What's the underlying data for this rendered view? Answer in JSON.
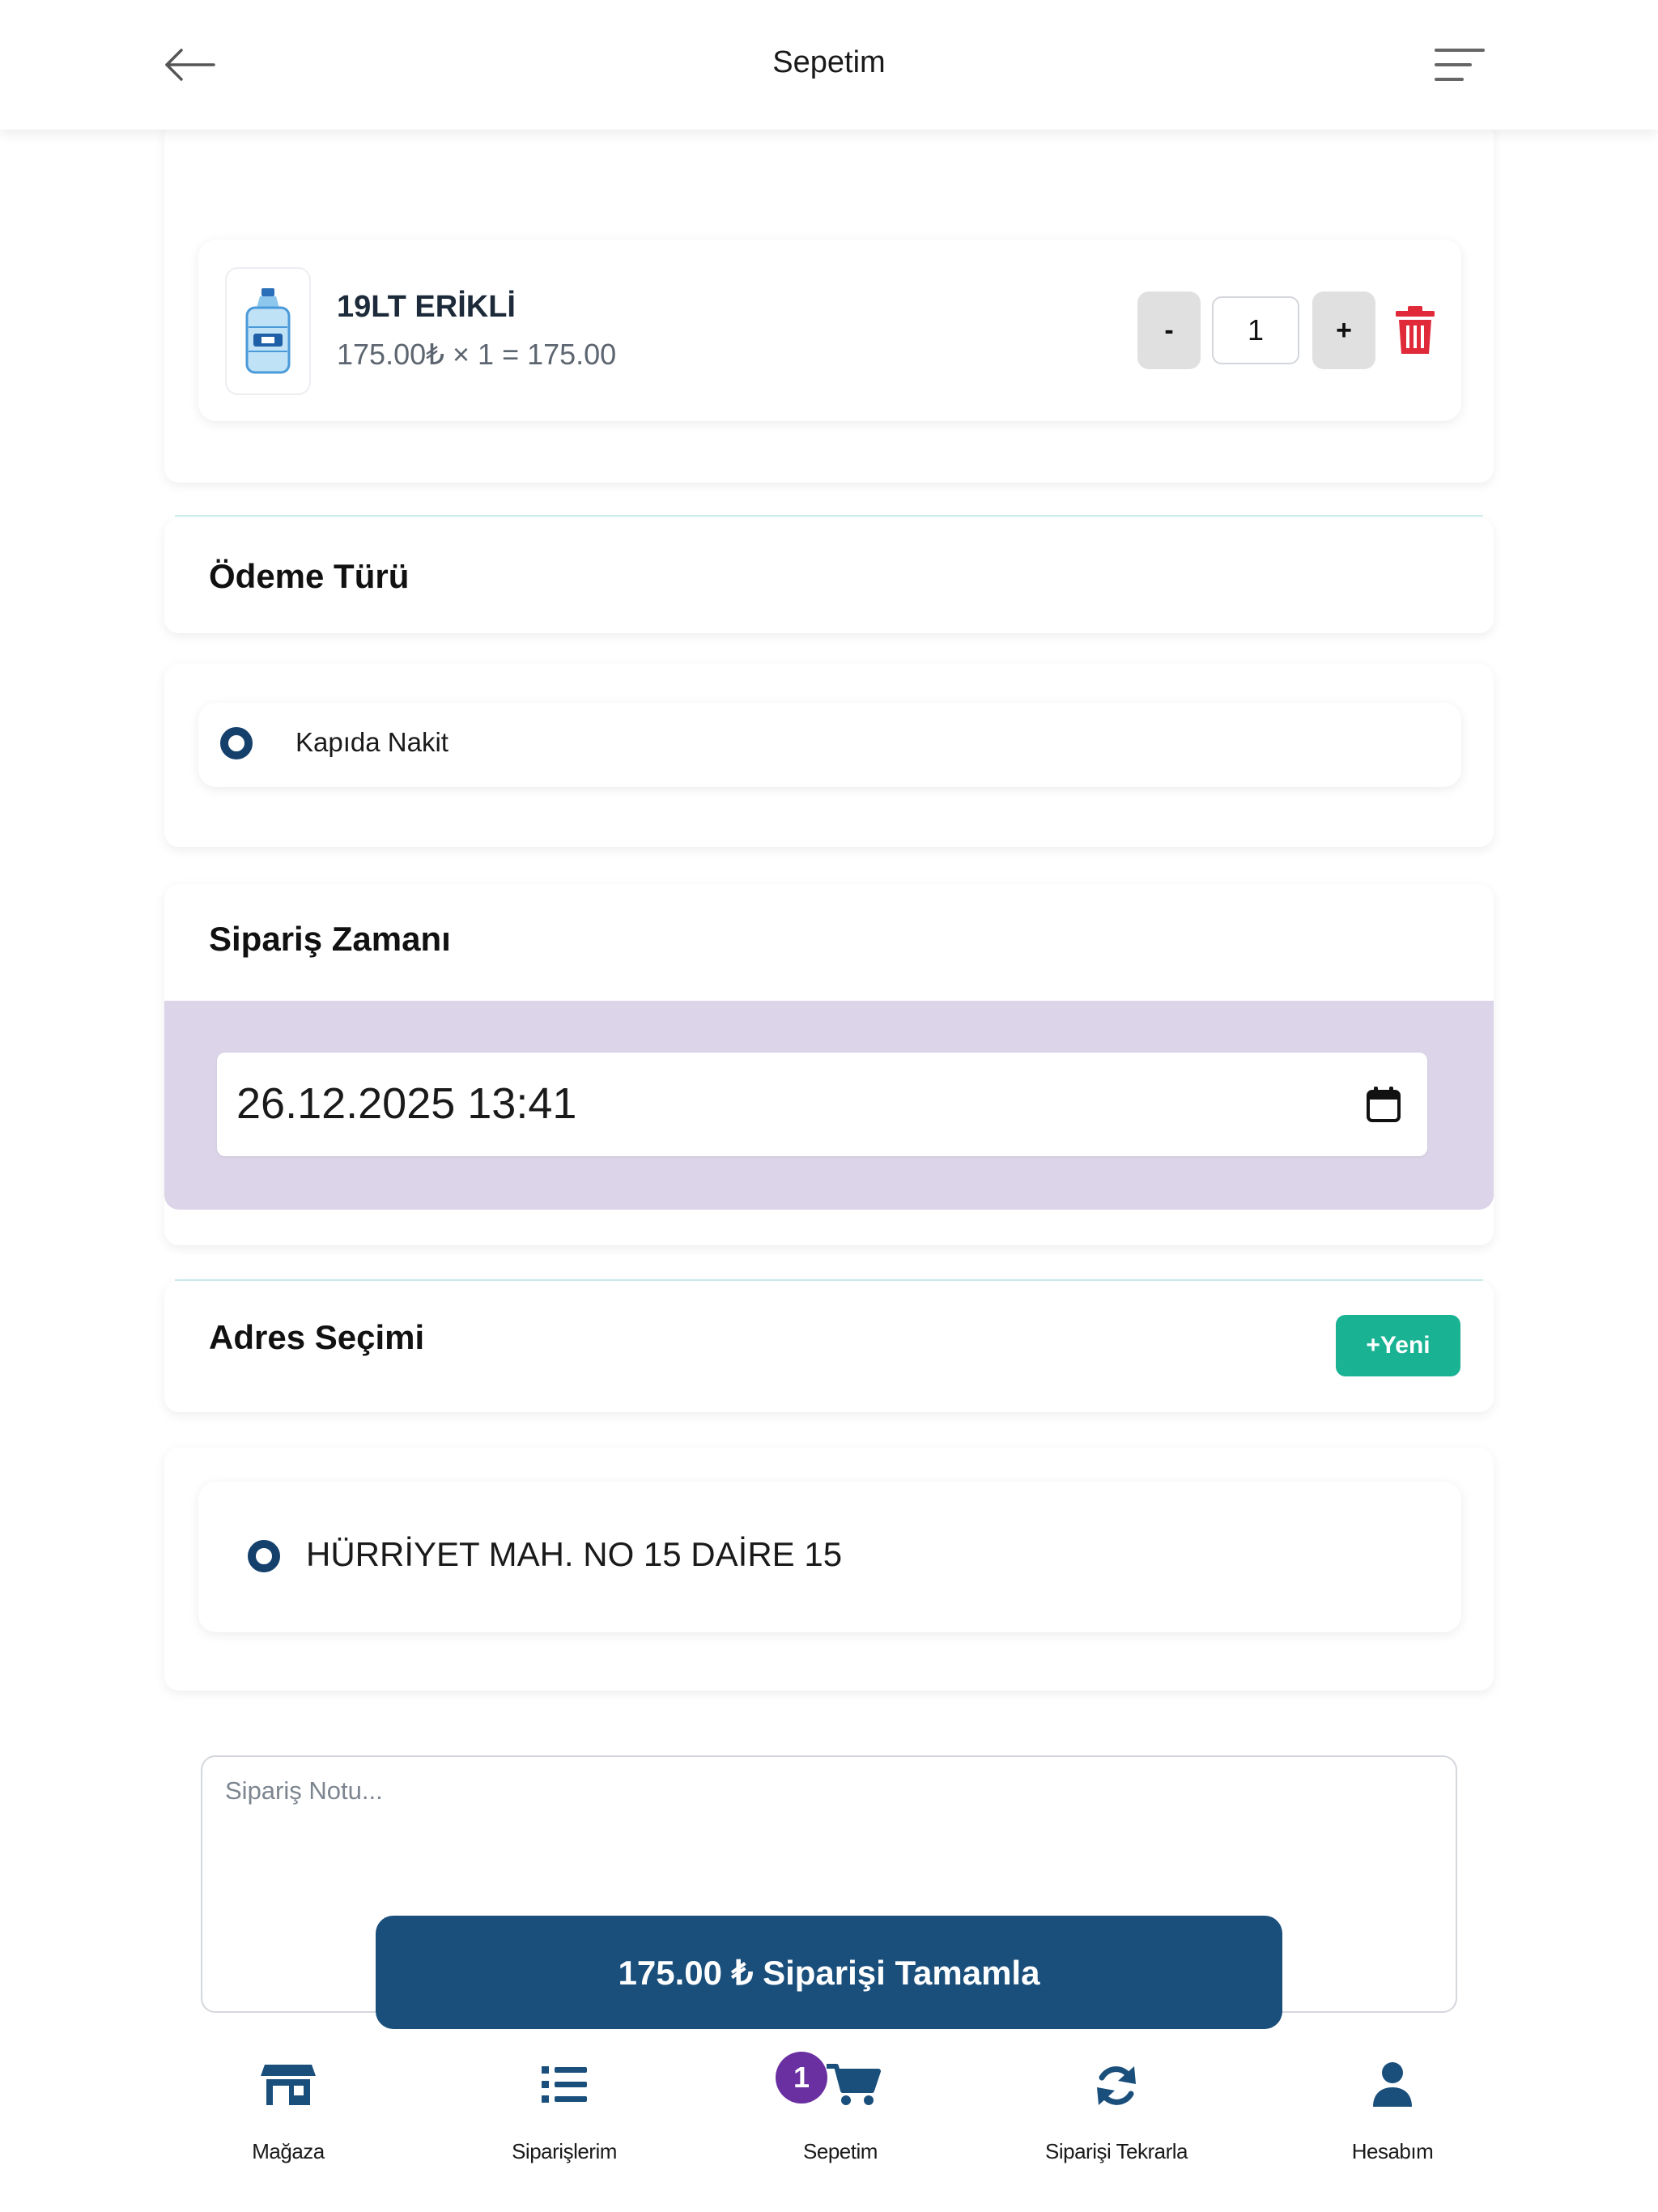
{
  "header": {
    "title": "Sepetim",
    "back_icon": "arrow-left-icon",
    "menu_icon": "menu-lines-icon"
  },
  "cart": {
    "items": [
      {
        "name": "19LT ERİKLİ",
        "price_line": "175.00₺ × 1 = 175.00",
        "quantity": "1",
        "minus_label": "-",
        "plus_label": "+",
        "image_icon": "water-bottle-icon",
        "delete_icon": "trash-icon"
      }
    ]
  },
  "payment": {
    "title": "Ödeme Türü",
    "options": [
      {
        "label": "Kapıda Nakit",
        "selected": true
      }
    ]
  },
  "order_time": {
    "title": "Sipariş Zamanı",
    "value": "26.12.2025 13:41",
    "icon": "calendar-icon"
  },
  "address": {
    "title": "Adres Seçimi",
    "new_button": "+Yeni",
    "options": [
      {
        "label": "HÜRRİYET MAH. NO 15 DAİRE 15",
        "selected": true
      }
    ]
  },
  "note": {
    "placeholder": "Sipariş Notu..."
  },
  "checkout": {
    "label": "175.00 ₺ Siparişi Tamamla"
  },
  "bottom_nav": {
    "items": [
      {
        "label": "Mağaza",
        "icon": "store-icon"
      },
      {
        "label": "Siparişlerim",
        "icon": "list-icon"
      },
      {
        "label": "Sepetim",
        "icon": "cart-icon",
        "badge": "1",
        "active": true
      },
      {
        "label": "Siparişi Tekrarla",
        "icon": "refresh-icon"
      },
      {
        "label": "Hesabım",
        "icon": "user-icon"
      }
    ]
  },
  "colors": {
    "primary": "#1a4f7c",
    "radio": "#14406b",
    "accent_green": "#19b394",
    "danger": "#e02a3a",
    "date_band": "#dcd4e8",
    "badge": "#6a2fa0"
  }
}
